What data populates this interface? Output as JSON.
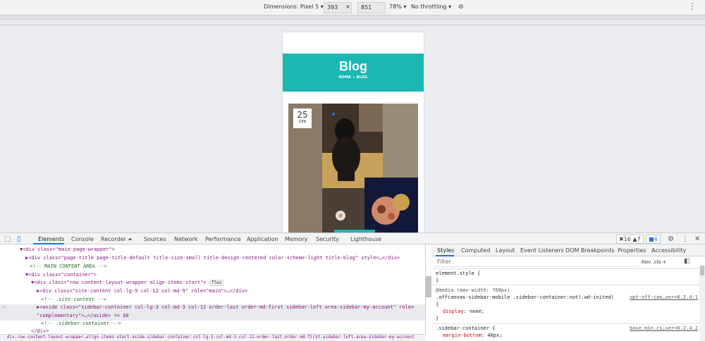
{
  "device_toolbar": {
    "dimensions_label": "Dimensions: Pixel 5 ▾",
    "width": "393",
    "height": "851",
    "zoom": "78% ▾",
    "throttling": "No throttling ▾",
    "more": "⋮"
  },
  "blog": {
    "title": "Blog",
    "breadcrumb": "HOME » BLOG",
    "date_day": "25",
    "date_month": "GEN"
  },
  "devtools": {
    "tabs": [
      "Elements",
      "Console",
      "Recorder ⏶",
      "Sources",
      "Network",
      "Performance",
      "Application",
      "Memory",
      "Security",
      "Lighthouse"
    ],
    "errors": "✖16 ▲7",
    "messages": "■4",
    "elements_lines": [
      {
        "indent": 0,
        "text": "▼<div class=\"main-page-wrapper\">"
      },
      {
        "indent": 1,
        "text": "▶<div class=\"page-title page-title-default title-size-small title-design-centered color-scheme-light title-blog\" style>…</div>"
      },
      {
        "indent": 1,
        "text": "<!-- MAIN CONTENT AREA -->"
      },
      {
        "indent": 1,
        "text": "▼<div class=\"container\">"
      },
      {
        "indent": 2,
        "text": "▼<div class=\"row content-layout-wrapper align-items-start\">"
      },
      {
        "indent": 3,
        "text": "▶<div class=\"site-content col-lg-9 col-12 col-md-9\" role=\"main\">…</div>"
      },
      {
        "indent": 3,
        "text": "<!-- .site-content -->"
      },
      {
        "indent": 3,
        "text": "▶<aside class=\"sidebar-container col-lg-3 col-md-3 col-12 order-last order-md-first sidebar-left area-sidebar-my-account\" role="
      },
      {
        "indent": 3,
        "text": "\"complementary\">…</aside> == $0"
      },
      {
        "indent": 3,
        "text": "<!-- .sidebar-container -->"
      },
      {
        "indent": 2,
        "text": "</div>"
      }
    ],
    "flex_badge": "flex",
    "breadcrumb": "div.row.content-layout-wrapper.align-items-start   aside.sidebar-container.col-lg-3.col-md-3.col-12.order-last.order-md-first.sidebar-left.area-sidebar-my-account",
    "styles_tabs": [
      "Styles",
      "Computed",
      "Layout",
      "Event Listeners",
      "DOM Breakpoints",
      "Properties",
      "Accessibility"
    ],
    "filter_placeholder": "Filter",
    "filter_tools": ":hov  .cls  +",
    "css_lines": {
      "element_style": "element.style {",
      "close1": "}",
      "media": "@media (max-width: 768px)",
      "selector2": ".offcanvas-sidebar-mobile .sidebar-container:not(.wd-inited)",
      "link2": "opt-off-can…ver=6.2.4:1",
      "open2": "{",
      "prop2": "display",
      "val2": ": none;",
      "close2": "}",
      "selector3": ".sidebar-container {",
      "link3": "base.min.cs…ver=6.2.4:2",
      "prop3": "margin-bottom",
      "val3": ": 40px;"
    }
  }
}
